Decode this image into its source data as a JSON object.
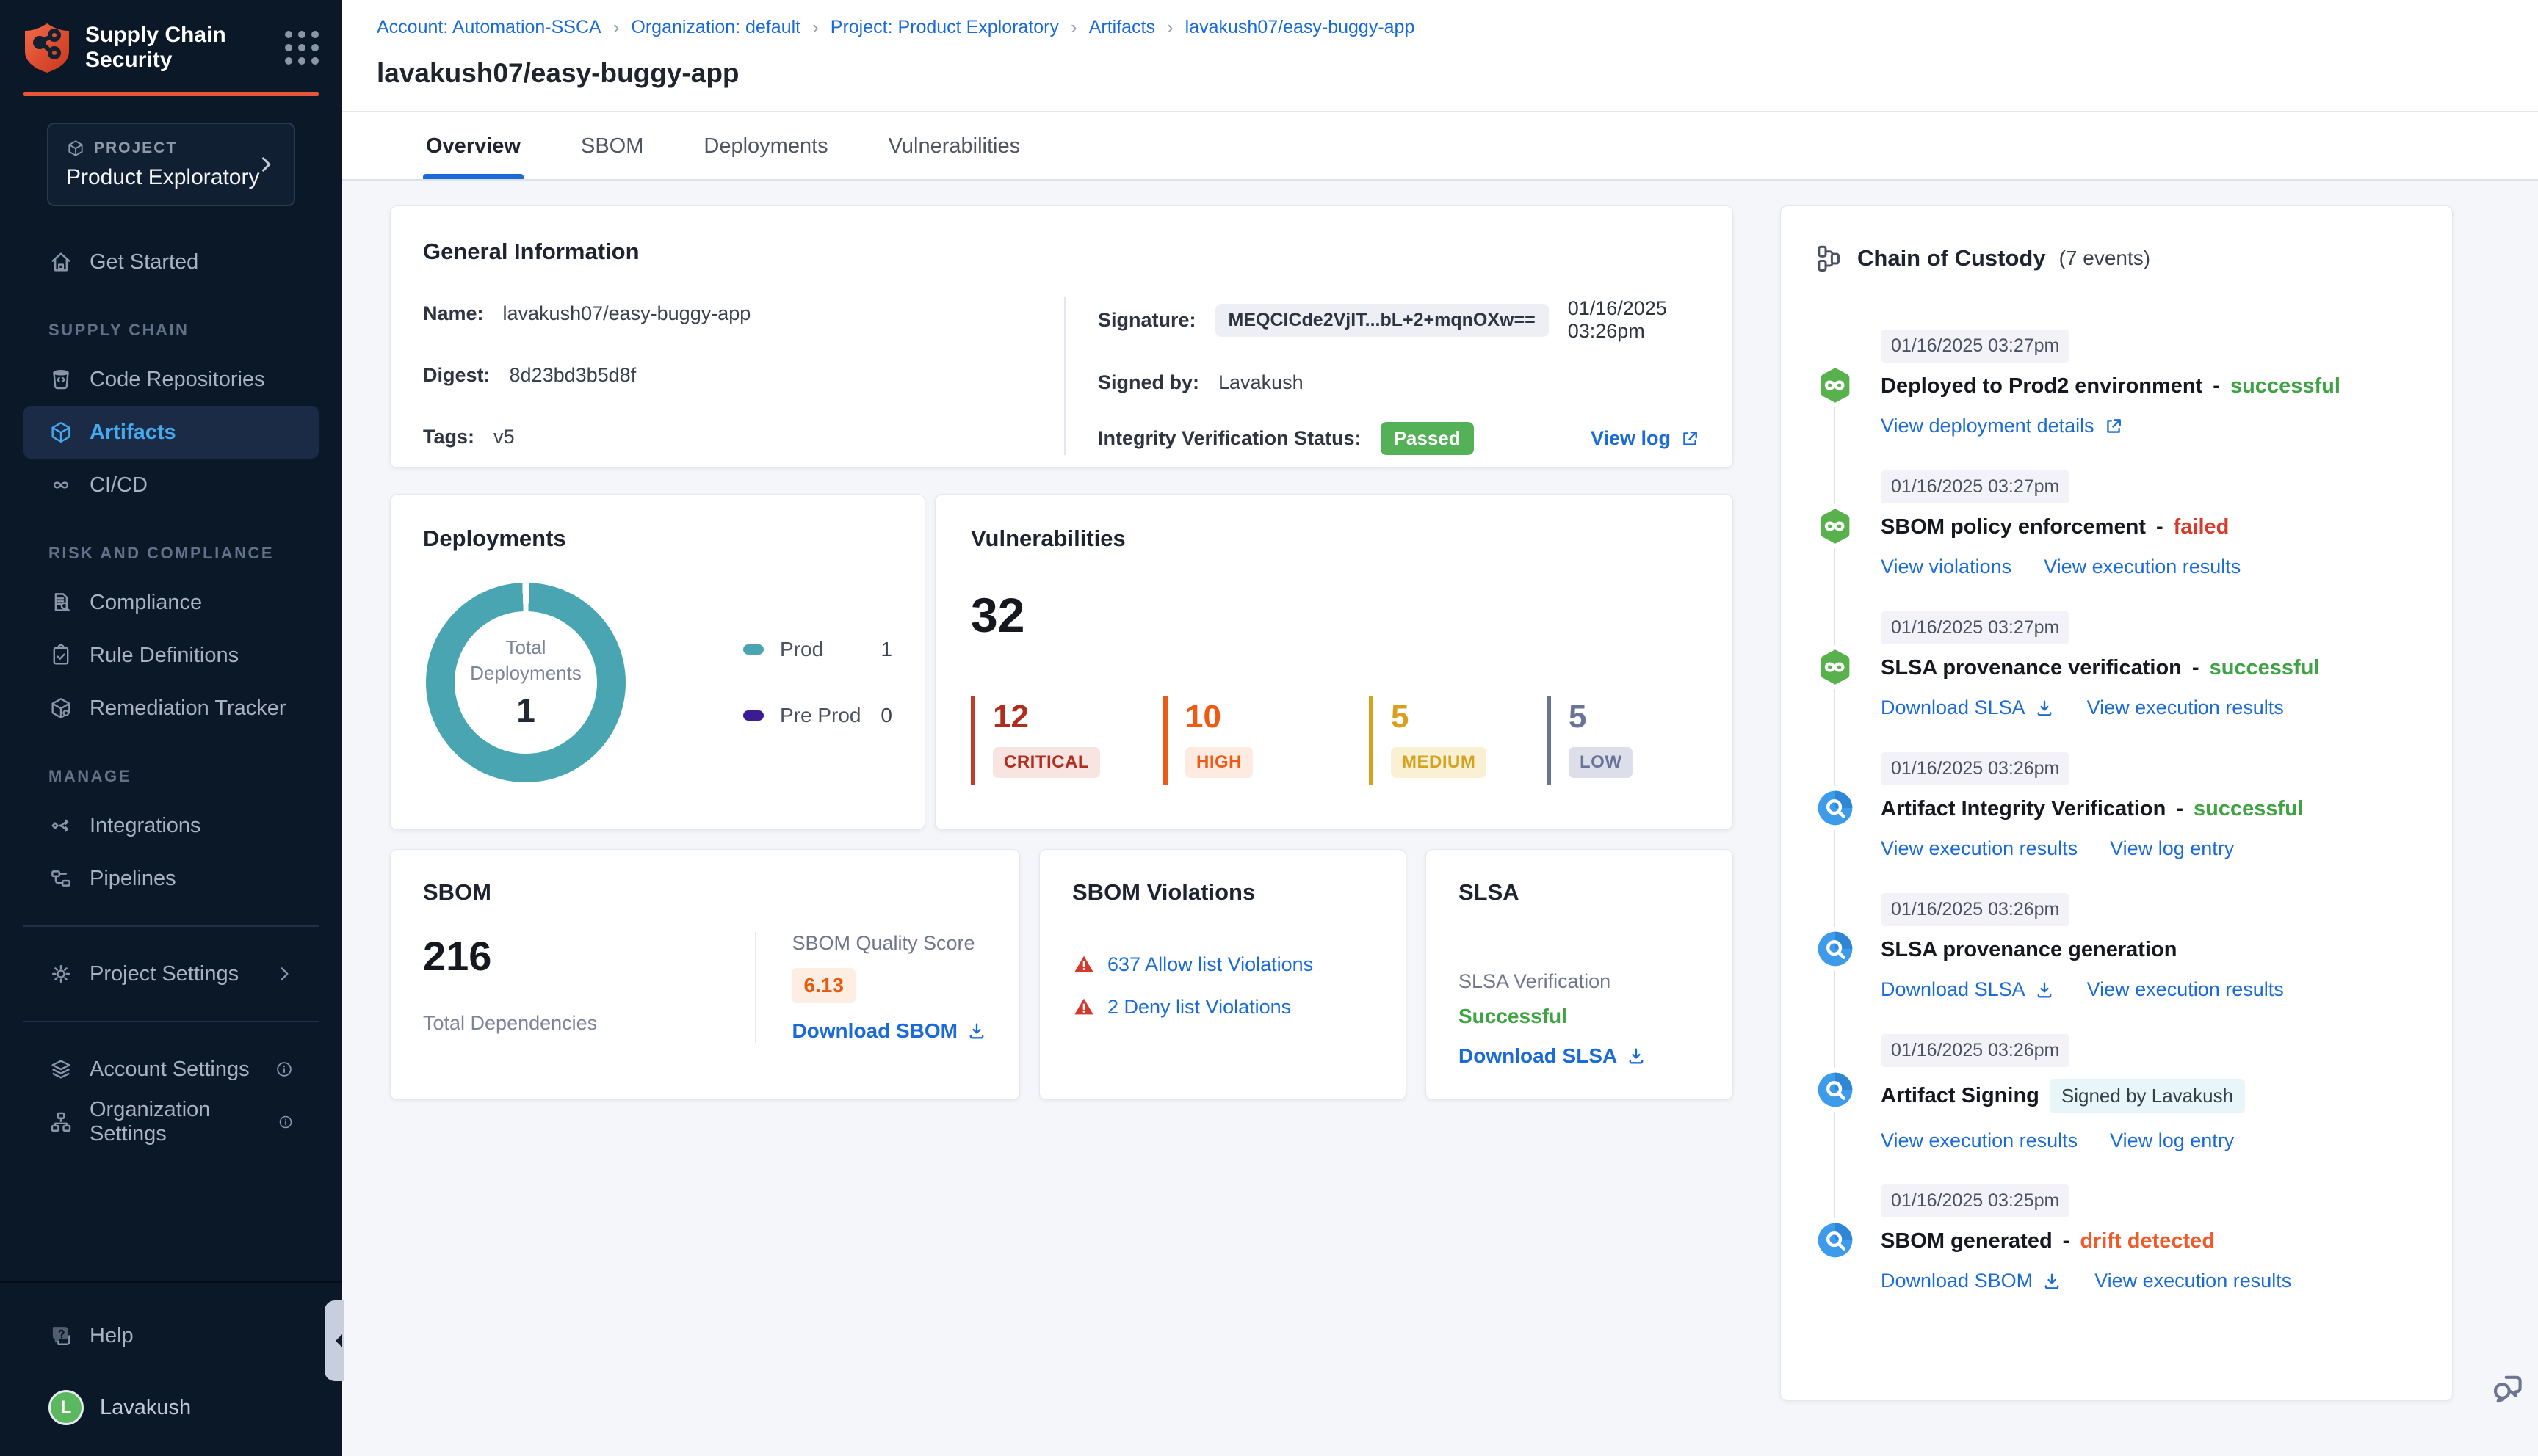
{
  "theme": {
    "brand_orange": "#E8563A",
    "link_blue": "#1A6BD8",
    "success_green": "#3FA344",
    "error_red": "#D63A2A",
    "warning_orange": "#F05A2B",
    "sidebar_bg": "#0B1828",
    "sidebar_active_blue": "#45AAF0",
    "content_bg": "#F4F6FA",
    "donut_teal": "#4AA5B2",
    "preprod_purple": "#3A1D92"
  },
  "brand": {
    "app_title": "Supply Chain Security"
  },
  "project_selector": {
    "kicker": "PROJECT",
    "name": "Product Exploratory"
  },
  "sidebar": {
    "get_started": "Get Started",
    "sections": [
      {
        "label": "SUPPLY CHAIN",
        "items": [
          {
            "label": "Code Repositories",
            "icon": "repo",
            "active": false
          },
          {
            "label": "Artifacts",
            "icon": "cube",
            "active": true
          },
          {
            "label": "CI/CD",
            "icon": "infinity",
            "active": false
          }
        ]
      },
      {
        "label": "RISK AND COMPLIANCE",
        "items": [
          {
            "label": "Compliance",
            "icon": "doc-search",
            "active": false
          },
          {
            "label": "Rule Definitions",
            "icon": "clipboard-check",
            "active": false
          },
          {
            "label": "Remediation Tracker",
            "icon": "box-gear",
            "active": false
          }
        ]
      },
      {
        "label": "MANAGE",
        "items": [
          {
            "label": "Integrations",
            "icon": "integrations",
            "active": false
          },
          {
            "label": "Pipelines",
            "icon": "pipelines",
            "active": false
          }
        ]
      }
    ],
    "project_settings": "Project Settings",
    "account_settings": "Account Settings",
    "organization_settings": "Organization Settings",
    "help": "Help",
    "user": {
      "name": "Lavakush",
      "avatar_initial": "L",
      "avatar_color": "#5CB85F"
    }
  },
  "breadcrumb": [
    "Account: Automation-SSCA",
    "Organization: default",
    "Project: Product Exploratory",
    "Artifacts",
    "lavakush07/easy-buggy-app"
  ],
  "page": {
    "title": "lavakush07/easy-buggy-app",
    "tabs": [
      {
        "label": "Overview",
        "active": true
      },
      {
        "label": "SBOM",
        "active": false
      },
      {
        "label": "Deployments",
        "active": false
      },
      {
        "label": "Vulnerabilities",
        "active": false
      }
    ]
  },
  "general_info": {
    "title": "General Information",
    "name_label": "Name:",
    "name": "lavakush07/easy-buggy-app",
    "digest_label": "Digest:",
    "digest": "8d23bd3b5d8f",
    "tags_label": "Tags:",
    "tags": "v5",
    "signature_label": "Signature:",
    "signature": "MEQCICde2VjIT...bL+2+mqnOXw==",
    "signature_time": "01/16/2025 03:26pm",
    "signed_by_label": "Signed by:",
    "signed_by": "Lavakush",
    "integrity_label": "Integrity Verification Status:",
    "integrity_status": "Passed",
    "view_log_label": "View log"
  },
  "deployments": {
    "title": "Deployments",
    "center_label": "Total Deployments",
    "total": 1,
    "legend": [
      {
        "label": "Prod",
        "value": 1,
        "color": "#4AA5B2"
      },
      {
        "label": "Pre Prod",
        "value": 0,
        "color": "#3A1D92"
      }
    ],
    "chart_data": {
      "type": "pie",
      "categories": [
        "Prod",
        "Pre Prod"
      ],
      "values": [
        1,
        0
      ],
      "title": "Total Deployments",
      "center_total": 1,
      "legend_position": "right"
    }
  },
  "vulnerabilities": {
    "title": "Vulnerabilities",
    "total": 32,
    "severities": [
      {
        "label": "CRITICAL",
        "value": 12,
        "color": "#B02E20",
        "badge_bg": "#F8E5E2",
        "bar": "#C43B2B"
      },
      {
        "label": "HIGH",
        "value": 10,
        "color": "#ED5A13",
        "badge_bg": "#FDEAE0",
        "bar": "#ED5A13"
      },
      {
        "label": "MEDIUM",
        "value": 5,
        "color": "#D6A21E",
        "badge_bg": "#FAF1D4",
        "bar": "#D6A21E"
      },
      {
        "label": "LOW",
        "value": 5,
        "color": "#6A739A",
        "badge_bg": "#DCDFE9",
        "bar": "#6A739A"
      }
    ],
    "chart_data": {
      "type": "bar",
      "categories": [
        "CRITICAL",
        "HIGH",
        "MEDIUM",
        "LOW"
      ],
      "values": [
        12,
        10,
        5,
        5
      ],
      "title": "Vulnerabilities",
      "total": 32
    }
  },
  "sbom": {
    "title": "SBOM",
    "total": 216,
    "total_label": "Total Dependencies",
    "quality_label": "SBOM Quality Score",
    "quality_score": "6.13",
    "download_label": "Download SBOM"
  },
  "sbom_violations": {
    "title": "SBOM Violations",
    "items": [
      {
        "label": "637 Allow list Violations"
      },
      {
        "label": "2 Deny list Violations"
      }
    ]
  },
  "slsa": {
    "title": "SLSA",
    "verification_label": "SLSA Verification",
    "status": "Successful",
    "download_label": "Download SLSA"
  },
  "chain_of_custody": {
    "title": "Chain of Custody",
    "count_label": "(7 events)",
    "events": [
      {
        "time": "01/16/2025 03:27pm",
        "icon": "cd",
        "title": "Deployed to Prod2 environment",
        "status": "successful",
        "status_color": "green",
        "links": [
          {
            "label": "View deployment details",
            "icon": "external"
          }
        ]
      },
      {
        "time": "01/16/2025 03:27pm",
        "icon": "cd",
        "title": "SBOM policy enforcement",
        "status": "failed",
        "status_color": "red",
        "links": [
          {
            "label": "View violations"
          },
          {
            "label": "View execution results"
          }
        ]
      },
      {
        "time": "01/16/2025 03:27pm",
        "icon": "cd",
        "title": "SLSA provenance verification",
        "status": "successful",
        "status_color": "green",
        "links": [
          {
            "label": "Download SLSA",
            "icon": "download"
          },
          {
            "label": "View execution results"
          }
        ]
      },
      {
        "time": "01/16/2025 03:26pm",
        "icon": "ci",
        "title": "Artifact Integrity Verification",
        "status": "successful",
        "status_color": "green",
        "links": [
          {
            "label": "View execution results"
          },
          {
            "label": "View log entry"
          }
        ]
      },
      {
        "time": "01/16/2025 03:26pm",
        "icon": "ci",
        "title": "SLSA provenance generation",
        "links": [
          {
            "label": "Download SLSA",
            "icon": "download"
          },
          {
            "label": "View execution results"
          }
        ]
      },
      {
        "time": "01/16/2025 03:26pm",
        "icon": "ci",
        "title": "Artifact Signing",
        "badge": "Signed by Lavakush",
        "links": [
          {
            "label": "View execution results"
          },
          {
            "label": "View log entry"
          }
        ]
      },
      {
        "time": "01/16/2025 03:25pm",
        "icon": "ci",
        "title": "SBOM generated",
        "status": "drift detected",
        "status_color": "orange",
        "links": [
          {
            "label": "Download SBOM",
            "icon": "download"
          },
          {
            "label": "View execution results"
          }
        ]
      }
    ]
  }
}
